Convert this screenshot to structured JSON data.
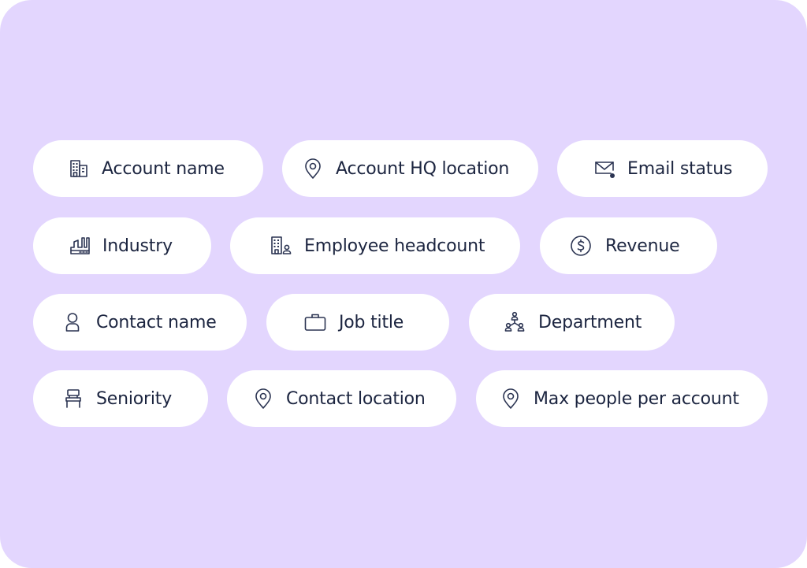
{
  "colors": {
    "background": "#e3d6fe",
    "pill": "#ffffff",
    "text": "#1c2540",
    "icon": "#2b3452"
  },
  "filters": [
    {
      "label": "Account name",
      "icon": "building-icon"
    },
    {
      "label": "Account HQ location",
      "icon": "map-pin-icon"
    },
    {
      "label": "Email status",
      "icon": "mail-status-icon"
    },
    {
      "label": "Industry",
      "icon": "factory-icon"
    },
    {
      "label": "Employee headcount",
      "icon": "building-person-icon"
    },
    {
      "label": "Revenue",
      "icon": "dollar-circle-icon"
    },
    {
      "label": "Contact name",
      "icon": "user-icon"
    },
    {
      "label": "Job title",
      "icon": "briefcase-icon"
    },
    {
      "label": "Department",
      "icon": "org-chart-icon"
    },
    {
      "label": "Seniority",
      "icon": "chair-icon"
    },
    {
      "label": "Contact location",
      "icon": "map-pin-icon"
    },
    {
      "label": "Max people per account",
      "icon": "map-pin-icon"
    }
  ]
}
